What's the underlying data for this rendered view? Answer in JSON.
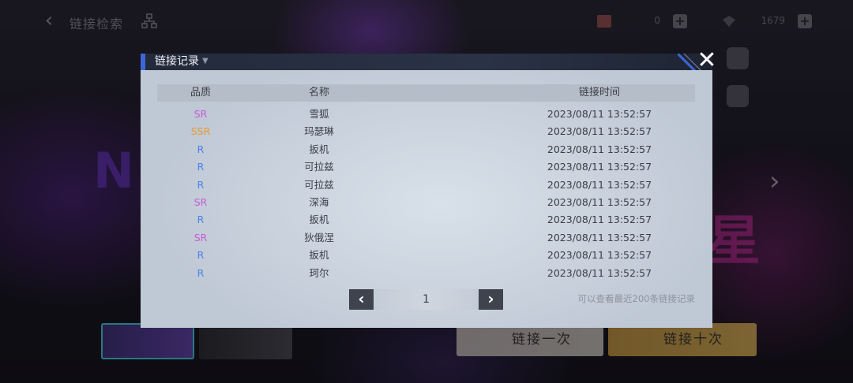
{
  "background": {
    "top_title": "链接检索",
    "currency_1_value": "0",
    "currency_2_value": "1679",
    "plus_label": "+",
    "neon_text_left": "N",
    "neon_text_right": "星",
    "summon_once_label": "链接一次",
    "summon_ten_label": "链接十次"
  },
  "modal": {
    "title": "链接记录",
    "close_symbol": "✕",
    "columns": {
      "quality": "品质",
      "name": "名称",
      "time": "链接时间"
    },
    "rows": [
      {
        "quality": "SR",
        "name": "雪狐",
        "time": "2023/08/11 13:52:57"
      },
      {
        "quality": "SSR",
        "name": "玛瑟琳",
        "time": "2023/08/11 13:52:57"
      },
      {
        "quality": "R",
        "name": "扳机",
        "time": "2023/08/11 13:52:57"
      },
      {
        "quality": "R",
        "name": "可拉兹",
        "time": "2023/08/11 13:52:57"
      },
      {
        "quality": "R",
        "name": "可拉兹",
        "time": "2023/08/11 13:52:57"
      },
      {
        "quality": "SR",
        "name": "深海",
        "time": "2023/08/11 13:52:57"
      },
      {
        "quality": "R",
        "name": "扳机",
        "time": "2023/08/11 13:52:57"
      },
      {
        "quality": "SR",
        "name": "狄俄涅",
        "time": "2023/08/11 13:52:57"
      },
      {
        "quality": "R",
        "name": "扳机",
        "time": "2023/08/11 13:52:57"
      },
      {
        "quality": "R",
        "name": "珂尔",
        "time": "2023/08/11 13:52:57"
      }
    ],
    "pagination": {
      "prev_symbol": "‹",
      "current_page": "1",
      "next_symbol": "›"
    },
    "footnote": "可以查看最近200条链接记录"
  },
  "quality_colors": {
    "SR": "#c75bd6",
    "SSR": "#e89a2c",
    "R": "#4d82e8"
  },
  "icons": {
    "back": "chevron-left-icon",
    "tree": "hierarchy-icon",
    "close": "close-icon",
    "prev": "chevron-left-icon",
    "next": "chevron-right-icon"
  }
}
